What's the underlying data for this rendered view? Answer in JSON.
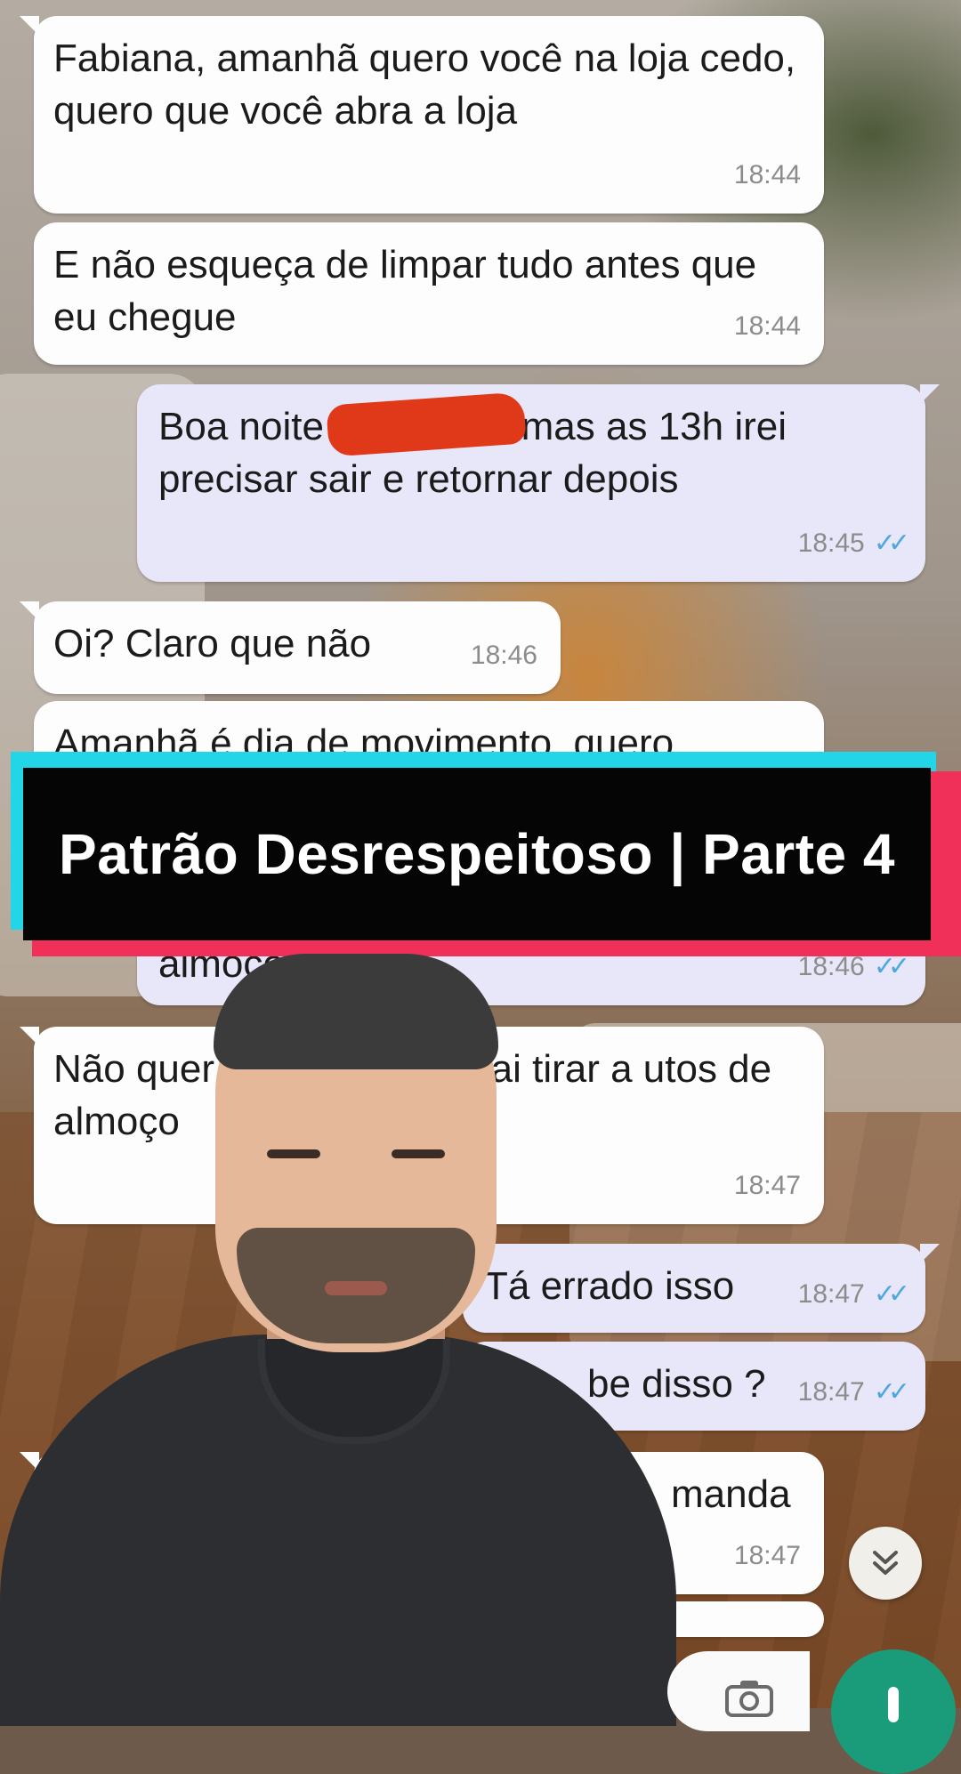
{
  "messages": [
    {
      "text": "Fabiana, amanhã quero você na loja cedo, quero que você abra a loja",
      "time": "18:44",
      "side": "in"
    },
    {
      "text": "E não esqueça de limpar tudo antes que eu chegue",
      "time": "18:44",
      "side": "in"
    },
    {
      "text": "Boa noite ! Tá certo, mas as 13h irei precisar sair e retornar depois",
      "time": "18:45",
      "side": "out",
      "status": "read"
    },
    {
      "text": "Oi? Claro que não",
      "time": "18:46",
      "side": "in"
    },
    {
      "text": "Amanhã é dia de movimento, quero",
      "time": "",
      "side": "in"
    },
    {
      "text": "almoço",
      "time": "18:46",
      "side": "out",
      "status": "read"
    },
    {
      "text": "Não quer amanhã você vai tirar a utos de almoço",
      "time": "18:47",
      "side": "in"
    },
    {
      "text": "Tá errado isso",
      "time": "18:47",
      "side": "out",
      "status": "read"
    },
    {
      "text": "be disso ?",
      "time": "18:47",
      "side": "out",
      "status": "read"
    },
    {
      "text": "manda",
      "time": "18:47",
      "side": "in"
    }
  ],
  "banner": {
    "title": "Patrão Desrespeitoso | Parte 4"
  },
  "icons": {
    "scroll": "chevron-double-down-icon",
    "camera": "camera-icon",
    "mic": "mic-icon",
    "read_receipt": "double-check-icon"
  },
  "colors": {
    "incoming_bubble": "#fdfdfd",
    "outgoing_bubble": "#e8e7f9",
    "read_tick": "#4fa7dc",
    "banner_cyan": "#22d6e8",
    "banner_red": "#f1305a",
    "mic_button": "#1a9c7b"
  }
}
